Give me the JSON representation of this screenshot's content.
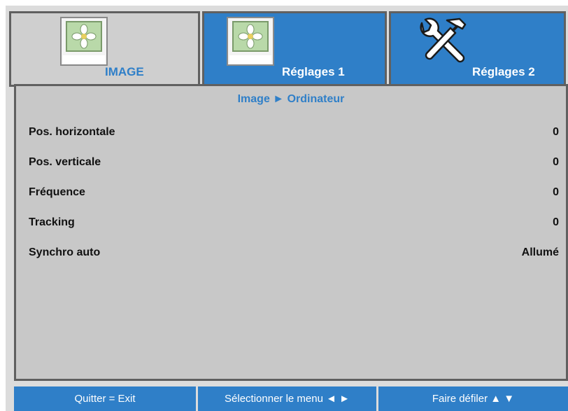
{
  "tabs": [
    {
      "label": "IMAGE",
      "icon": "image-flower-icon",
      "active": false
    },
    {
      "label": "Réglages 1",
      "icon": "image-flower-icon",
      "active": true
    },
    {
      "label": "Réglages 2",
      "icon": "tools-icon",
      "active": true
    }
  ],
  "breadcrumb": "Image ► Ordinateur",
  "settings": [
    {
      "label": "Pos. horizontale",
      "value": "0"
    },
    {
      "label": "Pos. verticale",
      "value": "0"
    },
    {
      "label": "Fréquence",
      "value": "0"
    },
    {
      "label": "Tracking",
      "value": "0"
    },
    {
      "label": "Synchro auto",
      "value": "Allumé"
    }
  ],
  "footer": {
    "exit": "Quitter = Exit",
    "select": "Sélectionner le menu ◄ ►",
    "scroll": "Faire défiler ▲ ▼"
  },
  "colors": {
    "accent_blue": "#2f7fc8",
    "panel_gray": "#c8c8c8",
    "border_gray": "#606060"
  }
}
